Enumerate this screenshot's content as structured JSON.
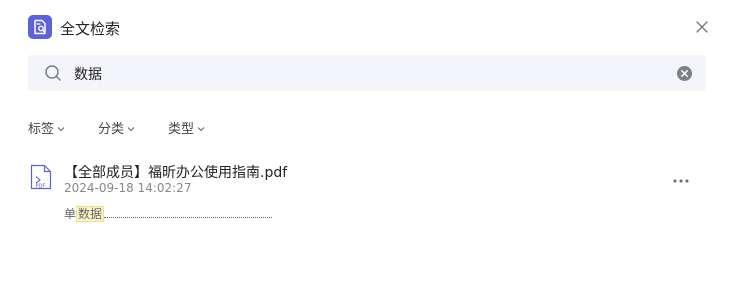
{
  "header": {
    "title": "全文检索",
    "app_icon": "search-document-icon",
    "close_icon": "close-icon"
  },
  "search": {
    "value": "数据",
    "placeholder": "",
    "icon": "search-icon",
    "clear_icon": "clear-circle-icon"
  },
  "filters": [
    {
      "label": "标签"
    },
    {
      "label": "分类"
    },
    {
      "label": "类型"
    }
  ],
  "results": [
    {
      "file_name": "【全部成员】福昕办公使用指南.pdf",
      "timestamp": "2024-09-18 14:02:27",
      "snippet_prefix": "单",
      "snippet_match": "数据",
      "icon": "pdf-file-icon",
      "more_icon": "more-horizontal-icon"
    }
  ],
  "colors": {
    "accent": "#5b62dc",
    "search_bg": "#f4f5fb",
    "highlight_bg": "#fff4c8"
  }
}
